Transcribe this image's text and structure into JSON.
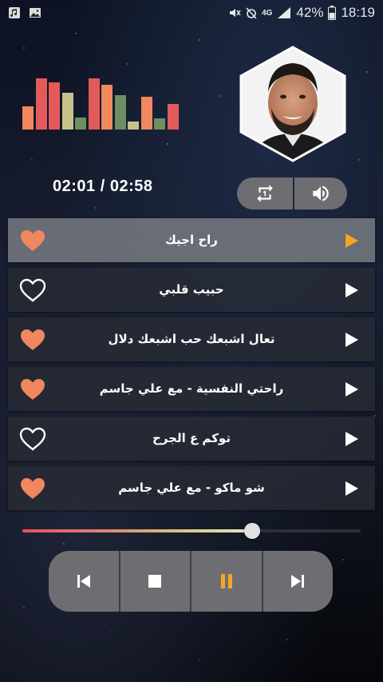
{
  "status_bar": {
    "network": "4G",
    "battery": "42%",
    "time": "18:19"
  },
  "now_playing": {
    "elapsed_time": "02:01 / 02:58",
    "progress_fraction": 0.68
  },
  "equalizer": {
    "bar_levels": [
      0.42,
      0.92,
      0.84,
      0.66,
      0.22,
      0.92,
      0.8,
      0.62,
      0.14,
      0.58,
      0.2,
      0.46
    ],
    "colors": [
      "#f0875f",
      "#e25a5a",
      "#c7c28b",
      "#6d8f62"
    ]
  },
  "tracks": [
    {
      "title": "راح اجيك",
      "favorite": true,
      "active": true
    },
    {
      "title": "حبيب قلبي",
      "favorite": false,
      "active": false
    },
    {
      "title": "تعال اشبعك حب اشبعك دلال",
      "favorite": true,
      "active": false
    },
    {
      "title": "راحتي النفسية - مع علي جاسم",
      "favorite": true,
      "active": false
    },
    {
      "title": "توكم ع الجرح",
      "favorite": false,
      "active": false
    },
    {
      "title": "شو ماكو - مع علي جاسم",
      "favorite": true,
      "active": false
    }
  ],
  "controls": {
    "repeat_icon": "repeat-one-icon",
    "volume_icon": "volume-icon",
    "player_icons": [
      "skip-previous-icon",
      "stop-icon",
      "pause-icon",
      "skip-next-icon"
    ]
  },
  "colors": {
    "accent": "#f0875f",
    "pause_accent": "#f5a623",
    "active_play": "#f5a623"
  }
}
